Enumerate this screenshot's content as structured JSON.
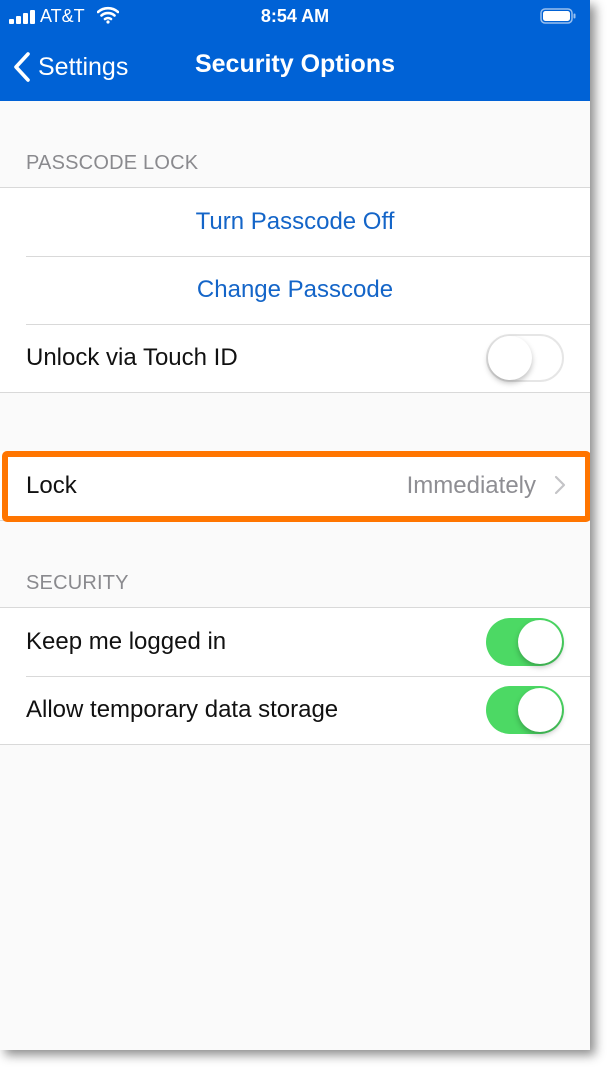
{
  "status_bar": {
    "carrier": "AT&T",
    "time": "8:54 AM",
    "signal_icon": "signal-bars-icon",
    "wifi_icon": "wifi-icon",
    "battery_icon": "battery-icon"
  },
  "nav": {
    "back_label": "Settings",
    "back_icon": "chevron-left-icon",
    "title": "Security Options",
    "background_color": "#0062d6"
  },
  "passcode_section": {
    "header": "PASSCODE LOCK",
    "turn_off_label": "Turn Passcode Off",
    "change_label": "Change Passcode",
    "touch_id": {
      "label": "Unlock via Touch ID",
      "enabled": false
    }
  },
  "lock_row": {
    "label": "Lock",
    "value": "Immediately",
    "chevron_icon": "chevron-right-icon",
    "highlight_color": "#ff7500"
  },
  "security_section": {
    "header": "SECURITY",
    "items": [
      {
        "label": "Keep me logged in",
        "enabled": true
      },
      {
        "label": "Allow temporary data storage",
        "enabled": true
      }
    ]
  },
  "colors": {
    "link": "#1465c8",
    "toggle_on": "#4cd964"
  }
}
